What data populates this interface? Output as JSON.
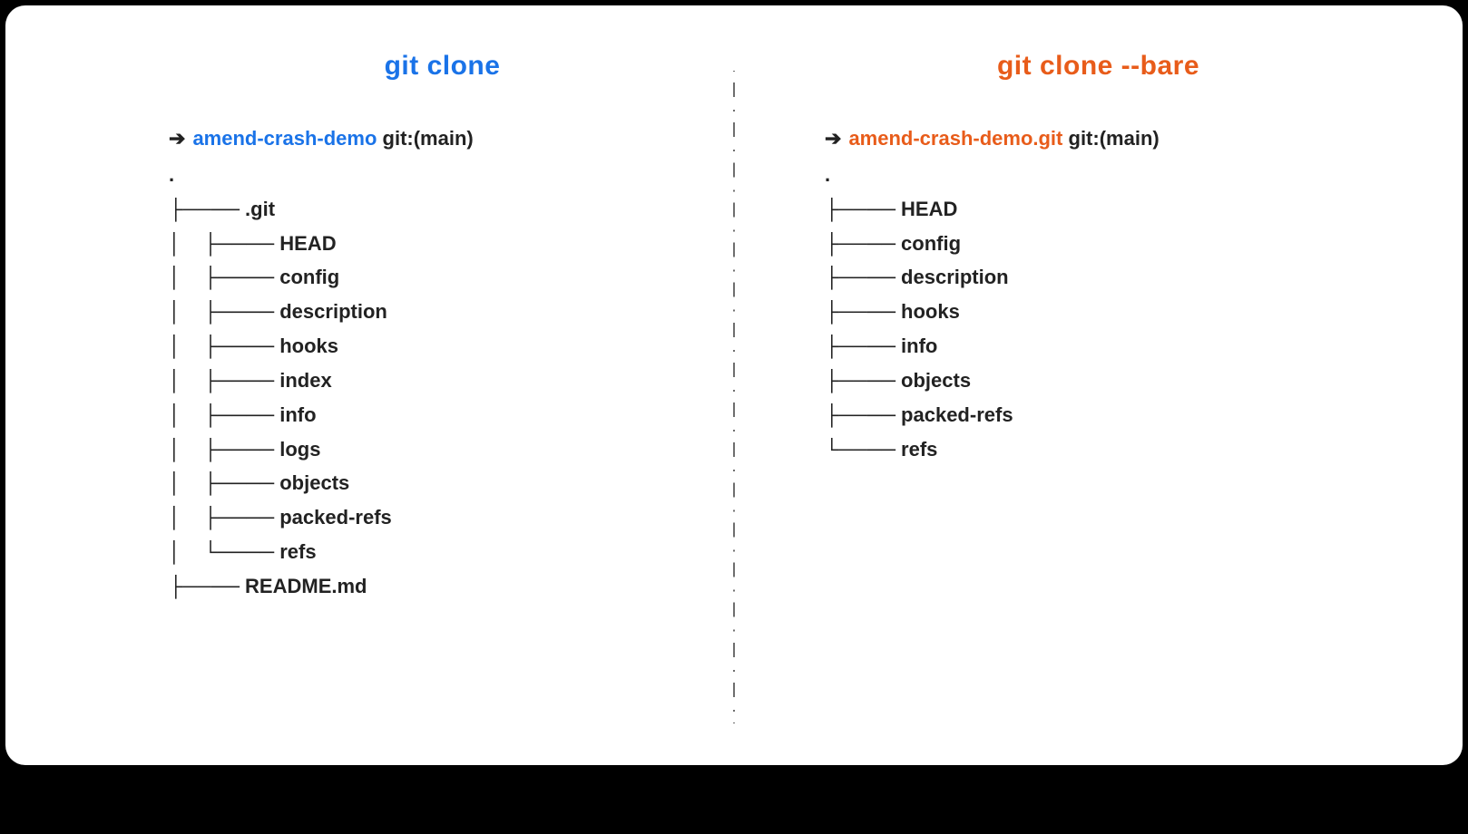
{
  "left": {
    "heading": "git clone",
    "arrow": "➔",
    "repo": "amend-crash-demo",
    "branch": "git:(main)",
    "root": ".",
    "tree": [
      {
        "glyph": "├──── ",
        "name": ".git"
      },
      {
        "glyph": "│    ├──── ",
        "name": "HEAD"
      },
      {
        "glyph": "│    ├──── ",
        "name": "config"
      },
      {
        "glyph": "│    ├──── ",
        "name": "description"
      },
      {
        "glyph": "│    ├──── ",
        "name": "hooks"
      },
      {
        "glyph": "│    ├──── ",
        "name": "index"
      },
      {
        "glyph": "│    ├──── ",
        "name": "info"
      },
      {
        "glyph": "│    ├──── ",
        "name": "logs"
      },
      {
        "glyph": "│    ├──── ",
        "name": "objects"
      },
      {
        "glyph": "│    ├──── ",
        "name": "packed-refs"
      },
      {
        "glyph": "│    └──── ",
        "name": "refs"
      },
      {
        "glyph": "├──── ",
        "name": "README.md"
      }
    ]
  },
  "right": {
    "heading": "git clone  --bare",
    "arrow": "➔",
    "repo": "amend-crash-demo.git",
    "branch": "git:(main)",
    "root": ".",
    "tree": [
      {
        "glyph": "├──── ",
        "name": "HEAD"
      },
      {
        "glyph": "├──── ",
        "name": "config"
      },
      {
        "glyph": "├──── ",
        "name": "description"
      },
      {
        "glyph": "├──── ",
        "name": "hooks"
      },
      {
        "glyph": "├──── ",
        "name": "info"
      },
      {
        "glyph": "├──── ",
        "name": "objects"
      },
      {
        "glyph": "├──── ",
        "name": "packed-refs"
      },
      {
        "glyph": "└──── ",
        "name": "refs"
      }
    ]
  }
}
